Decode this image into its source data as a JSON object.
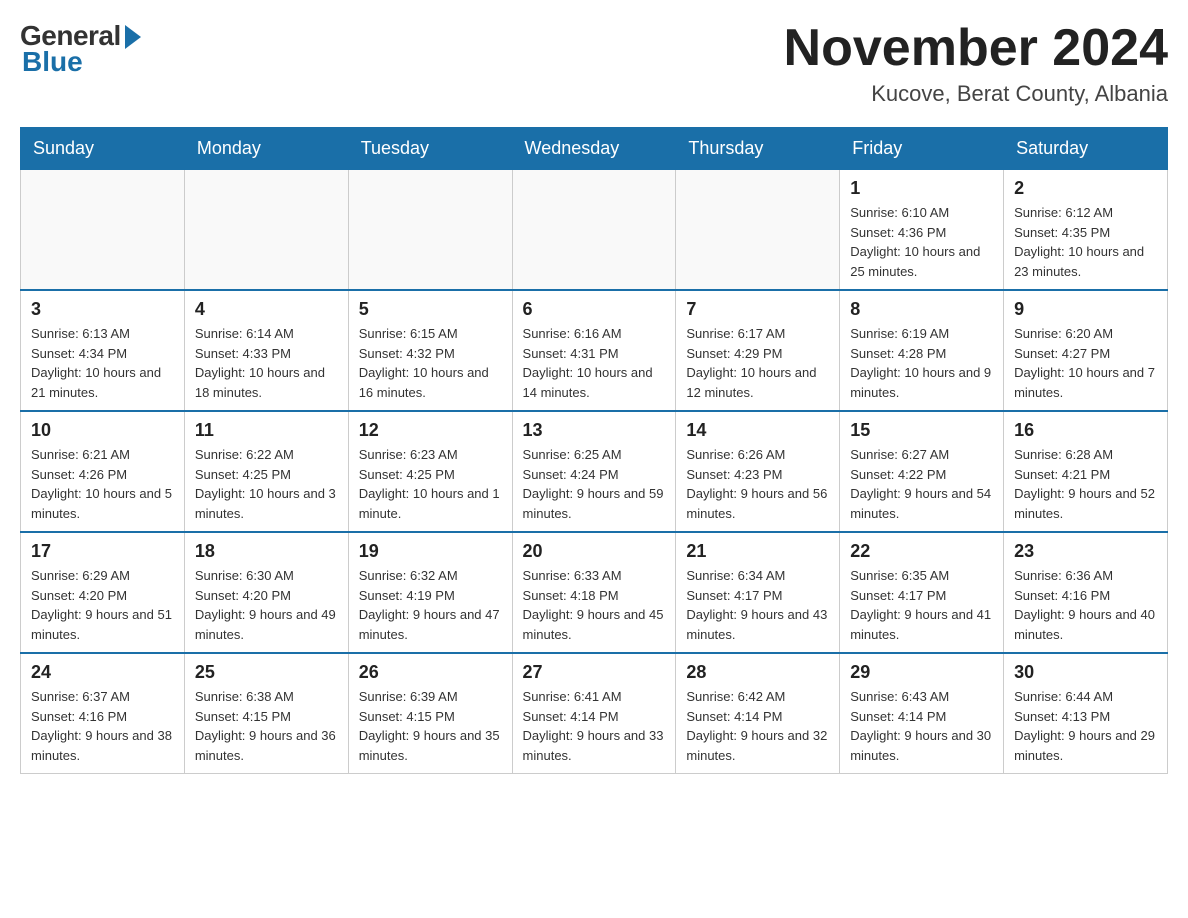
{
  "logo": {
    "general": "General",
    "blue": "Blue"
  },
  "header": {
    "title": "November 2024",
    "subtitle": "Kucove, Berat County, Albania"
  },
  "weekdays": [
    "Sunday",
    "Monday",
    "Tuesday",
    "Wednesday",
    "Thursday",
    "Friday",
    "Saturday"
  ],
  "weeks": [
    [
      {
        "day": "",
        "info": ""
      },
      {
        "day": "",
        "info": ""
      },
      {
        "day": "",
        "info": ""
      },
      {
        "day": "",
        "info": ""
      },
      {
        "day": "",
        "info": ""
      },
      {
        "day": "1",
        "info": "Sunrise: 6:10 AM\nSunset: 4:36 PM\nDaylight: 10 hours and 25 minutes."
      },
      {
        "day": "2",
        "info": "Sunrise: 6:12 AM\nSunset: 4:35 PM\nDaylight: 10 hours and 23 minutes."
      }
    ],
    [
      {
        "day": "3",
        "info": "Sunrise: 6:13 AM\nSunset: 4:34 PM\nDaylight: 10 hours and 21 minutes."
      },
      {
        "day": "4",
        "info": "Sunrise: 6:14 AM\nSunset: 4:33 PM\nDaylight: 10 hours and 18 minutes."
      },
      {
        "day": "5",
        "info": "Sunrise: 6:15 AM\nSunset: 4:32 PM\nDaylight: 10 hours and 16 minutes."
      },
      {
        "day": "6",
        "info": "Sunrise: 6:16 AM\nSunset: 4:31 PM\nDaylight: 10 hours and 14 minutes."
      },
      {
        "day": "7",
        "info": "Sunrise: 6:17 AM\nSunset: 4:29 PM\nDaylight: 10 hours and 12 minutes."
      },
      {
        "day": "8",
        "info": "Sunrise: 6:19 AM\nSunset: 4:28 PM\nDaylight: 10 hours and 9 minutes."
      },
      {
        "day": "9",
        "info": "Sunrise: 6:20 AM\nSunset: 4:27 PM\nDaylight: 10 hours and 7 minutes."
      }
    ],
    [
      {
        "day": "10",
        "info": "Sunrise: 6:21 AM\nSunset: 4:26 PM\nDaylight: 10 hours and 5 minutes."
      },
      {
        "day": "11",
        "info": "Sunrise: 6:22 AM\nSunset: 4:25 PM\nDaylight: 10 hours and 3 minutes."
      },
      {
        "day": "12",
        "info": "Sunrise: 6:23 AM\nSunset: 4:25 PM\nDaylight: 10 hours and 1 minute."
      },
      {
        "day": "13",
        "info": "Sunrise: 6:25 AM\nSunset: 4:24 PM\nDaylight: 9 hours and 59 minutes."
      },
      {
        "day": "14",
        "info": "Sunrise: 6:26 AM\nSunset: 4:23 PM\nDaylight: 9 hours and 56 minutes."
      },
      {
        "day": "15",
        "info": "Sunrise: 6:27 AM\nSunset: 4:22 PM\nDaylight: 9 hours and 54 minutes."
      },
      {
        "day": "16",
        "info": "Sunrise: 6:28 AM\nSunset: 4:21 PM\nDaylight: 9 hours and 52 minutes."
      }
    ],
    [
      {
        "day": "17",
        "info": "Sunrise: 6:29 AM\nSunset: 4:20 PM\nDaylight: 9 hours and 51 minutes."
      },
      {
        "day": "18",
        "info": "Sunrise: 6:30 AM\nSunset: 4:20 PM\nDaylight: 9 hours and 49 minutes."
      },
      {
        "day": "19",
        "info": "Sunrise: 6:32 AM\nSunset: 4:19 PM\nDaylight: 9 hours and 47 minutes."
      },
      {
        "day": "20",
        "info": "Sunrise: 6:33 AM\nSunset: 4:18 PM\nDaylight: 9 hours and 45 minutes."
      },
      {
        "day": "21",
        "info": "Sunrise: 6:34 AM\nSunset: 4:17 PM\nDaylight: 9 hours and 43 minutes."
      },
      {
        "day": "22",
        "info": "Sunrise: 6:35 AM\nSunset: 4:17 PM\nDaylight: 9 hours and 41 minutes."
      },
      {
        "day": "23",
        "info": "Sunrise: 6:36 AM\nSunset: 4:16 PM\nDaylight: 9 hours and 40 minutes."
      }
    ],
    [
      {
        "day": "24",
        "info": "Sunrise: 6:37 AM\nSunset: 4:16 PM\nDaylight: 9 hours and 38 minutes."
      },
      {
        "day": "25",
        "info": "Sunrise: 6:38 AM\nSunset: 4:15 PM\nDaylight: 9 hours and 36 minutes."
      },
      {
        "day": "26",
        "info": "Sunrise: 6:39 AM\nSunset: 4:15 PM\nDaylight: 9 hours and 35 minutes."
      },
      {
        "day": "27",
        "info": "Sunrise: 6:41 AM\nSunset: 4:14 PM\nDaylight: 9 hours and 33 minutes."
      },
      {
        "day": "28",
        "info": "Sunrise: 6:42 AM\nSunset: 4:14 PM\nDaylight: 9 hours and 32 minutes."
      },
      {
        "day": "29",
        "info": "Sunrise: 6:43 AM\nSunset: 4:14 PM\nDaylight: 9 hours and 30 minutes."
      },
      {
        "day": "30",
        "info": "Sunrise: 6:44 AM\nSunset: 4:13 PM\nDaylight: 9 hours and 29 minutes."
      }
    ]
  ]
}
